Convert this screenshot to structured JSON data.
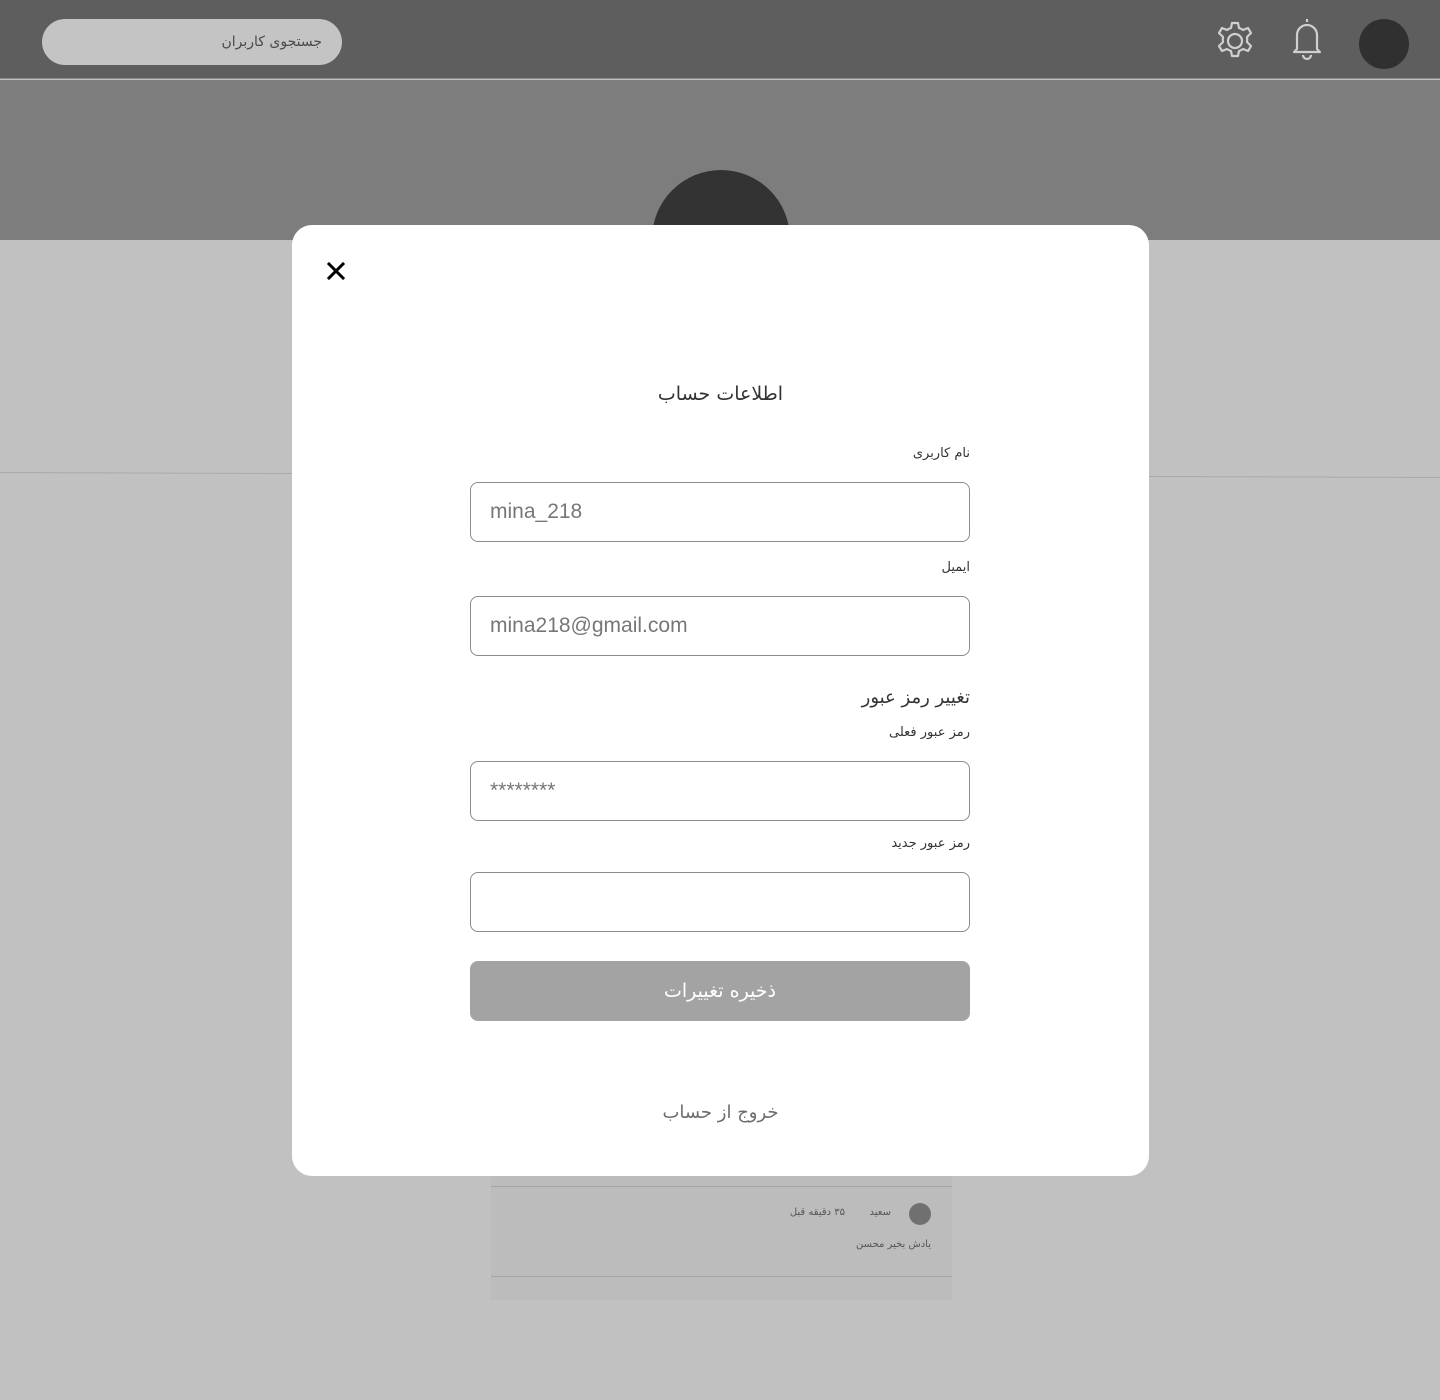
{
  "header": {
    "search_placeholder": "جستجوی کاربران"
  },
  "feed": {
    "comment": {
      "author": "سعید",
      "time": "۳۵ دقیقه قبل",
      "text": "یادش بخیر محسن"
    }
  },
  "modal": {
    "title": "اطلاعات حساب",
    "username_label": "نام کاربری",
    "username_value": "mina_218",
    "email_label": "ایمیل",
    "email_value": "mina218@gmail.com",
    "password_section_title": "تغییر رمز عبور",
    "current_password_label": "رمز عبور فعلی",
    "current_password_value": "********",
    "new_password_label": "رمز عبور جدید",
    "new_password_value": "",
    "save_label": "ذخیره تغییرات",
    "logout_label": "خروج از حساب"
  },
  "colors": {
    "topbar": "#5e5e5e",
    "banner": "#7d7d7d",
    "overlay_background": "#c1c1c1",
    "modal": "#ffffff",
    "save_button": "#a3a3a3"
  },
  "icons": [
    "gear-icon",
    "bell-icon",
    "close-icon"
  ]
}
